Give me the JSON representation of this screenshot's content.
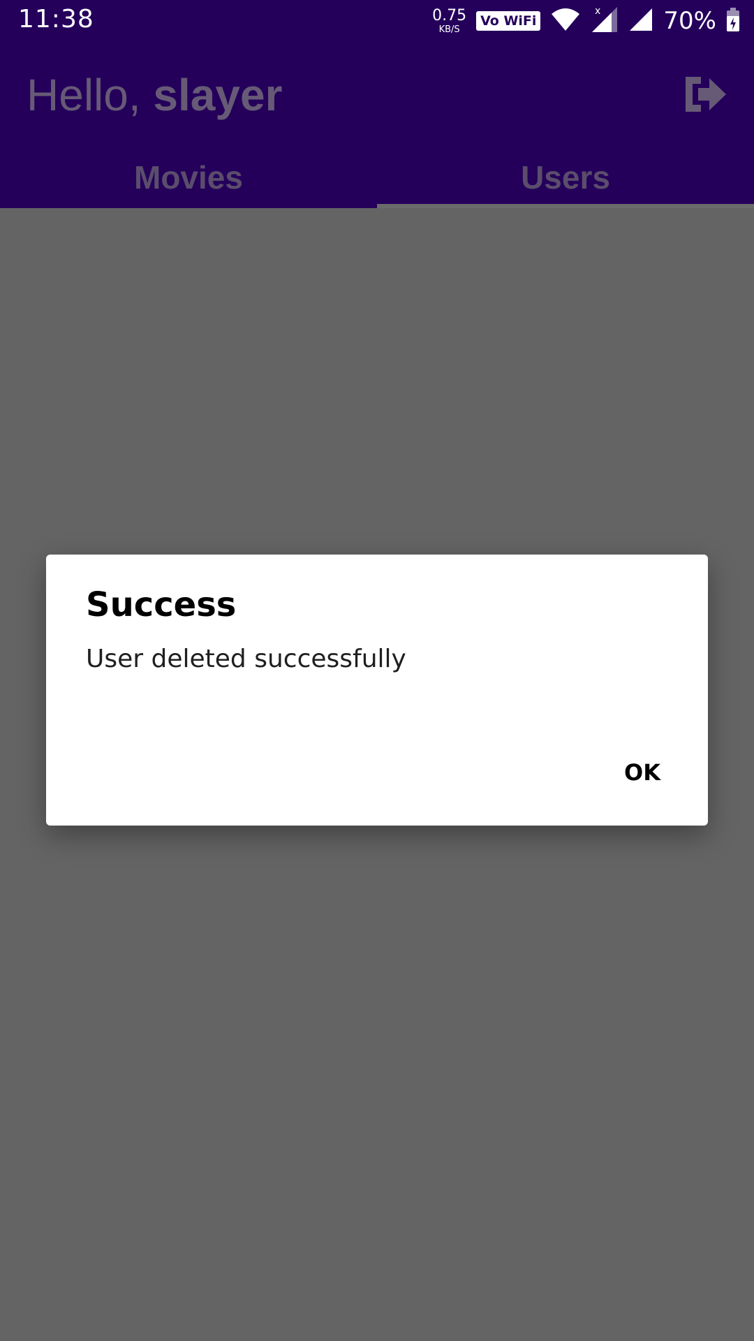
{
  "status_bar": {
    "time": "11:38",
    "net_speed_value": "0.75",
    "net_speed_unit": "KB/S",
    "vowifi_label": "Vo WiFi",
    "battery_percent": "70%",
    "icons": [
      "vowifi-icon",
      "wifi-icon",
      "cell-signal-x-icon",
      "cell-signal-icon",
      "battery-charging-icon"
    ]
  },
  "app_bar": {
    "greeting_prefix": "Hello, ",
    "username": "slayer",
    "logout_icon": "logout-icon",
    "tabs": [
      {
        "label": "Movies",
        "active": false
      },
      {
        "label": "Users",
        "active": true
      }
    ]
  },
  "dialog": {
    "title": "Success",
    "message": "User deleted successfully",
    "ok_label": "OK"
  },
  "colors": {
    "primary": "#24005b",
    "scrim": "#646464",
    "dialog_bg": "#ffffff"
  }
}
